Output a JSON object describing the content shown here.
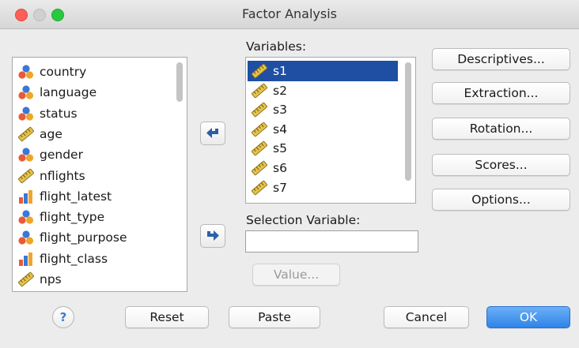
{
  "window": {
    "title": "Factor Analysis"
  },
  "source_list": {
    "items": [
      {
        "label": "country",
        "icon": "nominal-icon"
      },
      {
        "label": "language",
        "icon": "nominal-icon"
      },
      {
        "label": "status",
        "icon": "nominal-icon"
      },
      {
        "label": "age",
        "icon": "scale-icon"
      },
      {
        "label": "gender",
        "icon": "nominal-icon"
      },
      {
        "label": "nflights",
        "icon": "scale-icon"
      },
      {
        "label": "flight_latest",
        "icon": "ordinal-icon"
      },
      {
        "label": "flight_type",
        "icon": "nominal-icon"
      },
      {
        "label": "flight_purpose",
        "icon": "nominal-icon"
      },
      {
        "label": "flight_class",
        "icon": "ordinal-icon"
      },
      {
        "label": "nps",
        "icon": "scale-icon"
      }
    ]
  },
  "variables": {
    "label": "Variables:",
    "items": [
      {
        "label": "s1",
        "icon": "scale-icon",
        "selected": true
      },
      {
        "label": "s2",
        "icon": "scale-icon"
      },
      {
        "label": "s3",
        "icon": "scale-icon"
      },
      {
        "label": "s4",
        "icon": "scale-icon"
      },
      {
        "label": "s5",
        "icon": "scale-icon"
      },
      {
        "label": "s6",
        "icon": "scale-icon"
      },
      {
        "label": "s7",
        "icon": "scale-icon"
      }
    ]
  },
  "selection_variable": {
    "label": "Selection Variable:",
    "value": "",
    "value_button": "Value..."
  },
  "side_buttons": {
    "descriptives": "Descriptives...",
    "extraction": "Extraction...",
    "rotation": "Rotation...",
    "scores": "Scores...",
    "options": "Options..."
  },
  "footer": {
    "help": "?",
    "reset": "Reset",
    "paste": "Paste",
    "cancel": "Cancel",
    "ok": "OK"
  },
  "colors": {
    "selection": "#1f4fa3",
    "ok_button": "#2f83e8",
    "arrow": "#2d5fa8"
  }
}
